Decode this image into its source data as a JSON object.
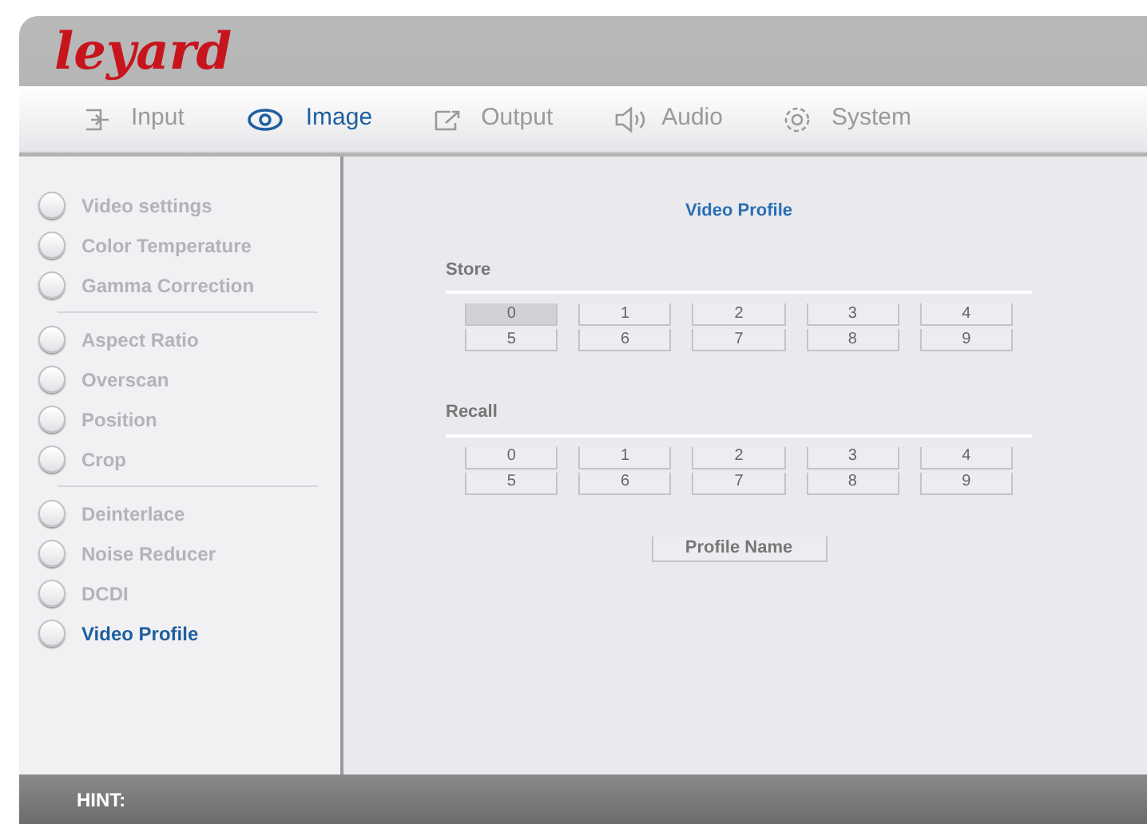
{
  "logo": "leyard",
  "tabs": [
    {
      "label": "Input",
      "kind": "input",
      "selected": false
    },
    {
      "label": "Image",
      "kind": "view",
      "selected": true
    },
    {
      "label": "Output",
      "kind": "output",
      "selected": false
    },
    {
      "label": "Audio",
      "kind": "audio",
      "selected": false
    },
    {
      "label": "System",
      "kind": "system",
      "selected": false
    }
  ],
  "sidebar": {
    "groups": [
      [
        {
          "label": "Video settings",
          "selected": false
        },
        {
          "label": "Color Temperature",
          "selected": false
        },
        {
          "label": "Gamma Correction",
          "selected": false
        }
      ],
      [
        {
          "label": "Aspect Ratio",
          "selected": false
        },
        {
          "label": "Overscan",
          "selected": false
        },
        {
          "label": "Position",
          "selected": false
        },
        {
          "label": "Crop",
          "selected": false
        }
      ],
      [
        {
          "label": "Deinterlace",
          "selected": false
        },
        {
          "label": "Noise Reducer",
          "selected": false
        },
        {
          "label": "DCDI",
          "selected": false
        },
        {
          "label": "Video Profile",
          "selected": true
        }
      ]
    ]
  },
  "main": {
    "title": "Video Profile",
    "sections": [
      {
        "label": "Store",
        "buttons": [
          {
            "label": "0",
            "selected": true
          },
          {
            "label": "1",
            "selected": false
          },
          {
            "label": "2",
            "selected": false
          },
          {
            "label": "3",
            "selected": false
          },
          {
            "label": "4",
            "selected": false
          },
          {
            "label": "5",
            "selected": false
          },
          {
            "label": "6",
            "selected": false
          },
          {
            "label": "7",
            "selected": false
          },
          {
            "label": "8",
            "selected": false
          },
          {
            "label": "9",
            "selected": false
          }
        ]
      },
      {
        "label": "Recall",
        "buttons": [
          {
            "label": "0",
            "selected": false
          },
          {
            "label": "1",
            "selected": false
          },
          {
            "label": "2",
            "selected": false
          },
          {
            "label": "3",
            "selected": false
          },
          {
            "label": "4",
            "selected": false
          },
          {
            "label": "5",
            "selected": false
          },
          {
            "label": "6",
            "selected": false
          },
          {
            "label": "7",
            "selected": false
          },
          {
            "label": "8",
            "selected": false
          },
          {
            "label": "9",
            "selected": false
          }
        ]
      }
    ],
    "profile_button": "Profile Name"
  },
  "hint": "HINT:"
}
